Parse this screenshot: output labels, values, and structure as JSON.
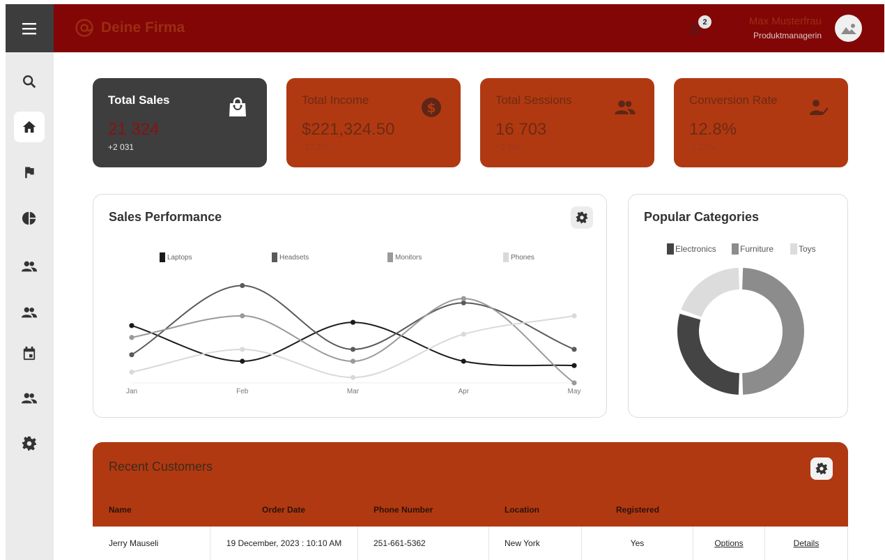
{
  "header": {
    "brand": "Deine Firma",
    "notifications_count": "2",
    "user_name": "Max Musterfrau",
    "user_role": "Produktmanagerin"
  },
  "sidebar": {
    "items": [
      {
        "icon": "search-icon"
      },
      {
        "icon": "home-icon",
        "active": true
      },
      {
        "icon": "flag-icon"
      },
      {
        "icon": "pie-chart-icon"
      },
      {
        "icon": "people-icon"
      },
      {
        "icon": "people-icon"
      },
      {
        "icon": "calendar-icon"
      },
      {
        "icon": "people-icon"
      },
      {
        "icon": "gear-icon"
      }
    ]
  },
  "stats": [
    {
      "title": "Total Sales",
      "value": "21 324",
      "delta": "+2 031",
      "icon": "shopping-bag-icon"
    },
    {
      "title": "Total Income",
      "value": "$221,324.50",
      "delta": "-$2,201",
      "icon": "dollar-icon"
    },
    {
      "title": "Total Sessions",
      "value": "16 703",
      "delta": "+3 392",
      "icon": "people-icon"
    },
    {
      "title": "Conversion Rate",
      "value": "12.8%",
      "delta": "-1.22%",
      "icon": "user-check-icon"
    }
  ],
  "sales_panel": {
    "title": "Sales Performance"
  },
  "categories_panel": {
    "title": "Popular Categories"
  },
  "chart_data": [
    {
      "type": "line",
      "title": "Sales Performance",
      "categories": [
        "Jan",
        "Feb",
        "Mar",
        "Apr",
        "May"
      ],
      "ylim": [
        0,
        100
      ],
      "grid": false,
      "legend": "top",
      "series": [
        {
          "name": "Laptops",
          "color": "#1a1a1a",
          "values": [
            53,
            20,
            56,
            20,
            16
          ]
        },
        {
          "name": "Headsets",
          "color": "#5a5a5a",
          "values": [
            26,
            90,
            31,
            74,
            31
          ]
        },
        {
          "name": "Monitors",
          "color": "#9a9a9a",
          "values": [
            42,
            62,
            20,
            78,
            0
          ]
        },
        {
          "name": "Phones",
          "color": "#d9d9d9",
          "values": [
            10,
            31,
            5,
            45,
            62
          ]
        }
      ]
    },
    {
      "type": "pie",
      "title": "Popular Categories",
      "legend": "top",
      "categories": [
        "Electronics",
        "Furniture",
        "Toys"
      ],
      "values": [
        30,
        50,
        20
      ],
      "colors": [
        "#444444",
        "#8c8c8c",
        "#dcdcdc"
      ]
    }
  ],
  "customers": {
    "title": "Recent Customers",
    "headers": [
      "Name",
      "Order Date",
      "Phone Number",
      "Location",
      "Registered"
    ],
    "rows": [
      {
        "name": "Jerry Mauseli",
        "date": "19 December, 2023 : 10:10 AM",
        "phone": "251-661-5362",
        "location": "New York",
        "registered": "Yes",
        "options": "Options",
        "details": "Details"
      }
    ]
  }
}
